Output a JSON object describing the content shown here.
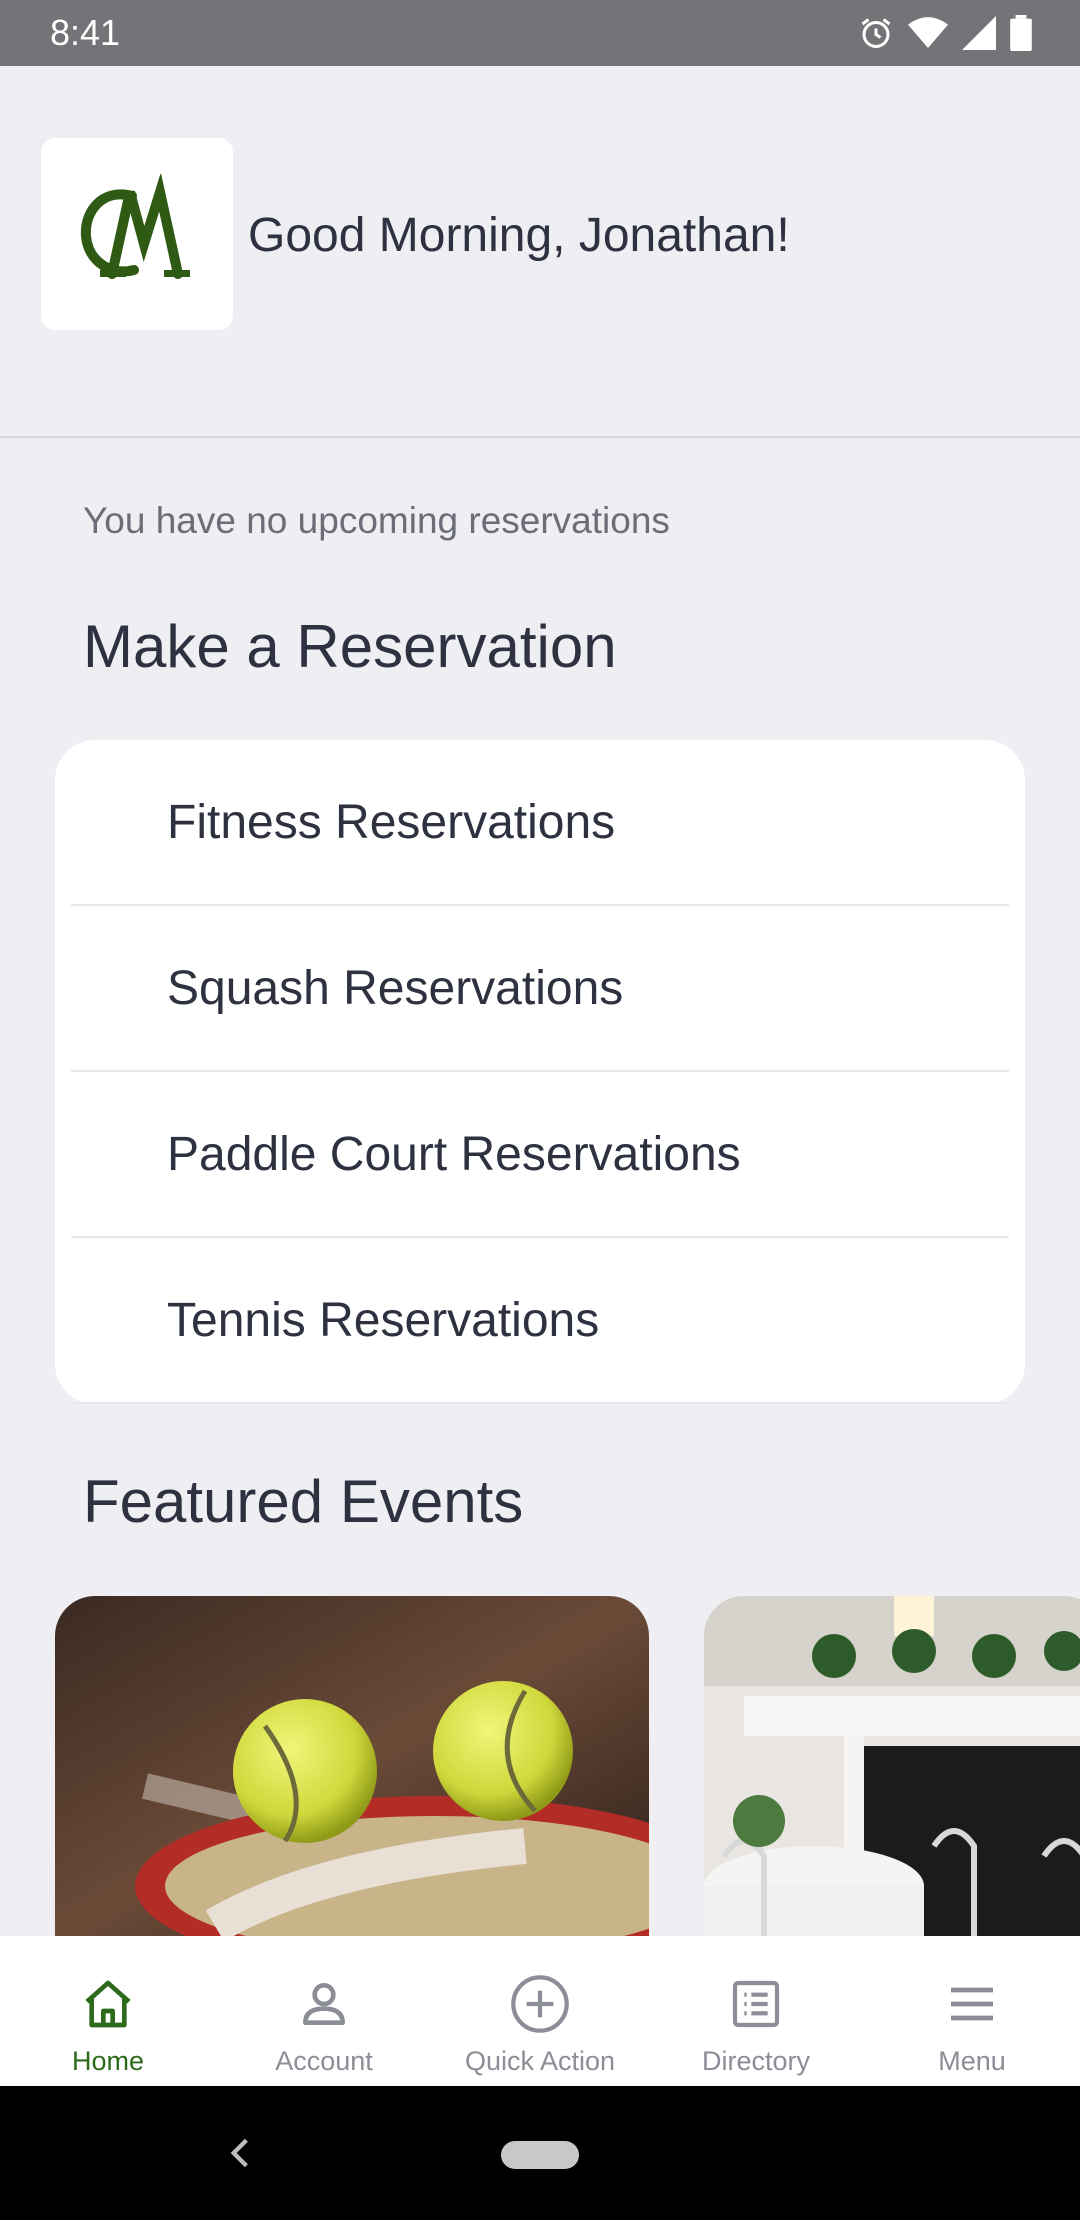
{
  "status_bar": {
    "time": "8:41"
  },
  "header": {
    "greeting": "Good Morning, Jonathan!"
  },
  "reservations": {
    "empty_message": "You have no upcoming reservations",
    "section_title": "Make a Reservation",
    "items": [
      {
        "label": "Fitness Reservations"
      },
      {
        "label": "Squash Reservations"
      },
      {
        "label": "Paddle Court Reservations"
      },
      {
        "label": "Tennis Reservations"
      }
    ]
  },
  "featured": {
    "section_title": "Featured Events"
  },
  "bottom_nav": {
    "items": [
      {
        "label": "Home",
        "icon": "home-icon",
        "active": true
      },
      {
        "label": "Account",
        "icon": "person-icon"
      },
      {
        "label": "Quick Action",
        "icon": "plus-circle-icon"
      },
      {
        "label": "Directory",
        "icon": "list-icon"
      },
      {
        "label": "Menu",
        "icon": "hamburger-icon"
      }
    ]
  },
  "colors": {
    "accent": "#2e6a1b",
    "background": "#eeeef3",
    "logo": "#2e5a14"
  }
}
